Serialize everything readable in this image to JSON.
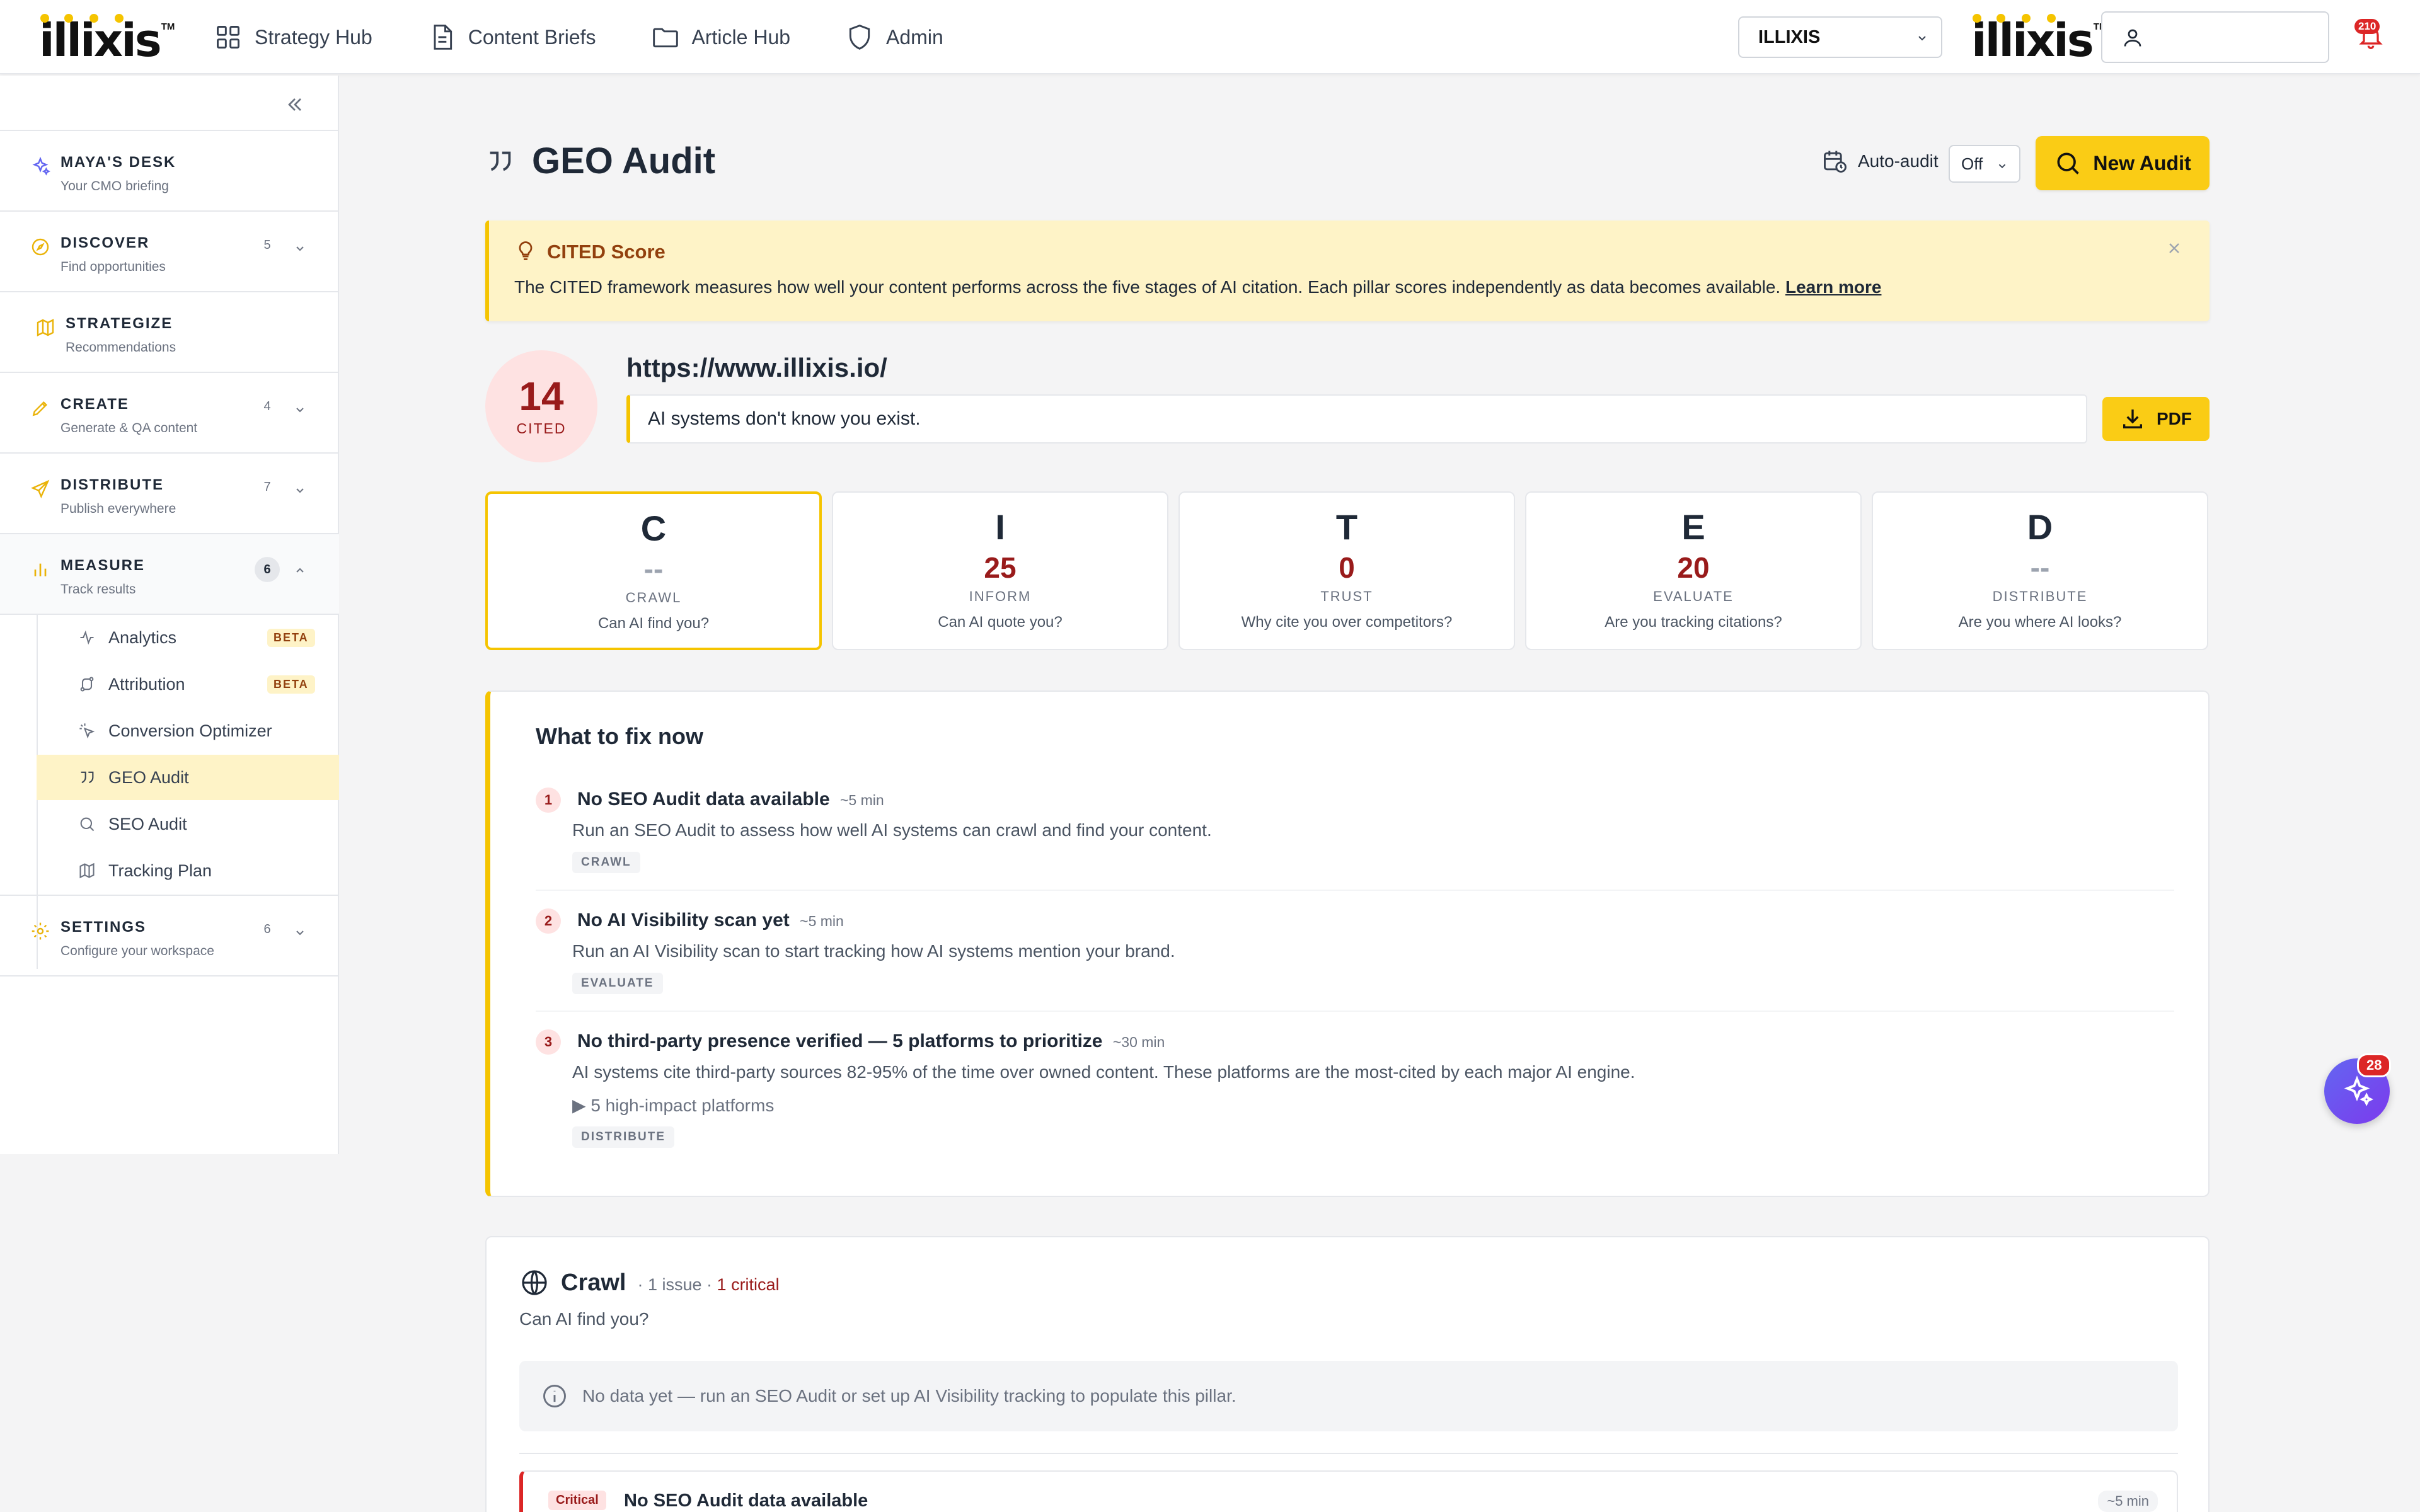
{
  "topbar": {
    "logo_text": "illixis",
    "logo_tm": "TM",
    "nav": [
      {
        "label": "Strategy Hub",
        "icon": "grid-icon"
      },
      {
        "label": "Content Briefs",
        "icon": "document-icon"
      },
      {
        "label": "Article Hub",
        "icon": "folder-icon"
      },
      {
        "label": "Admin",
        "icon": "shield-icon"
      }
    ],
    "org_selected": "ILLIXIS",
    "notification_count": "210",
    "brand_color": "#f5c400"
  },
  "sidebar": {
    "sections": [
      {
        "title": "MAYA'S DESK",
        "subtitle": "Your CMO briefing",
        "count": ""
      },
      {
        "title": "DISCOVER",
        "subtitle": "Find opportunities",
        "count": "5"
      },
      {
        "title": "STRATEGIZE",
        "subtitle": "Recommendations",
        "count": ""
      },
      {
        "title": "CREATE",
        "subtitle": "Generate & QA content",
        "count": "4"
      },
      {
        "title": "DISTRIBUTE",
        "subtitle": "Publish everywhere",
        "count": "7"
      },
      {
        "title": "MEASURE",
        "subtitle": "Track results",
        "count": "6"
      },
      {
        "title": "SETTINGS",
        "subtitle": "Configure your workspace",
        "count": "6"
      }
    ],
    "measure_items": [
      {
        "label": "Analytics",
        "badge": "BETA"
      },
      {
        "label": "Attribution",
        "badge": "BETA"
      },
      {
        "label": "Conversion Optimizer",
        "badge": ""
      },
      {
        "label": "GEO Audit",
        "badge": ""
      },
      {
        "label": "SEO Audit",
        "badge": ""
      },
      {
        "label": "Tracking Plan",
        "badge": ""
      }
    ]
  },
  "header": {
    "title": "GEO Audit",
    "auto_audit_label": "Auto-audit",
    "auto_audit_value": "Off",
    "new_audit_label": "New Audit"
  },
  "banner": {
    "title": "CITED Score",
    "text": "The CITED framework measures how well your content performs across the five stages of AI citation. Each pillar scores independently as data becomes available.",
    "link": "Learn more"
  },
  "score": {
    "value": "14",
    "label": "CITED",
    "url": "https://www.illixis.io/",
    "tagline": "AI systems don't know you exist.",
    "pdf_label": "PDF"
  },
  "pillars": [
    {
      "letter": "C",
      "score": "--",
      "name": "CRAWL",
      "question": "Can AI find you?"
    },
    {
      "letter": "I",
      "score": "25",
      "name": "INFORM",
      "question": "Can AI quote you?"
    },
    {
      "letter": "T",
      "score": "0",
      "name": "TRUST",
      "question": "Why cite you over competitors?"
    },
    {
      "letter": "E",
      "score": "20",
      "name": "EVALUATE",
      "question": "Are you tracking citations?"
    },
    {
      "letter": "D",
      "score": "--",
      "name": "DISTRIBUTE",
      "question": "Are you where AI looks?"
    }
  ],
  "fix": {
    "title": "What to fix now",
    "items": [
      {
        "num": "1",
        "title": "No SEO Audit data available",
        "time": "~5 min",
        "desc": "Run an SEO Audit to assess how well AI systems can crawl and find your content.",
        "tag": "CRAWL",
        "expand": ""
      },
      {
        "num": "2",
        "title": "No AI Visibility scan yet",
        "time": "~5 min",
        "desc": "Run an AI Visibility scan to start tracking how AI systems mention your brand.",
        "tag": "EVALUATE",
        "expand": ""
      },
      {
        "num": "3",
        "title": "No third-party presence verified — 5 platforms to prioritize",
        "time": "~30 min",
        "desc": "AI systems cite third-party sources 82-95% of the time over owned content. These platforms are the most-cited by each major AI engine.",
        "tag": "DISTRIBUTE",
        "expand": "▶ 5 high-impact platforms"
      }
    ]
  },
  "crawl": {
    "title": "Crawl",
    "meta_prefix": "· 1 issue ·",
    "meta_critical": "1 critical",
    "subtitle": "Can AI find you?",
    "nodata": "No data yet — run an SEO Audit or set up AI Visibility tracking to populate this pillar.",
    "issue_badge": "Critical",
    "issue_title": "No SEO Audit data available",
    "issue_time": "~5 min"
  },
  "assistant": {
    "badge_count": "28"
  }
}
